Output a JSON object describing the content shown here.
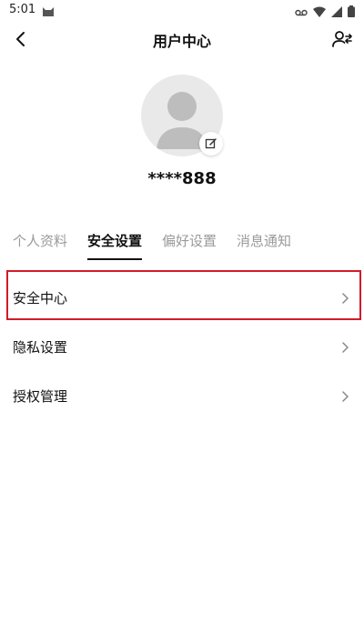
{
  "status_bar": {
    "time": "5:01",
    "icons": [
      "cat-icon",
      "voicemail-icon",
      "wifi-icon",
      "signal-icon",
      "battery-icon"
    ]
  },
  "header": {
    "title": "用户中心",
    "back_icon": "chevron-left-icon",
    "switch_icon": "user-switch-icon"
  },
  "profile": {
    "username": "****888",
    "avatar_icon": "avatar-placeholder-icon",
    "edit_icon": "edit-icon"
  },
  "tabs": [
    {
      "label": "个人资料",
      "active": false
    },
    {
      "label": "安全设置",
      "active": true
    },
    {
      "label": "偏好设置",
      "active": false
    },
    {
      "label": "消息通知",
      "active": false
    }
  ],
  "menu": [
    {
      "label": "安全中心",
      "highlighted": true
    },
    {
      "label": "隐私设置",
      "highlighted": false
    },
    {
      "label": "授权管理",
      "highlighted": false
    }
  ],
  "colors": {
    "accent": "#111111",
    "highlight_border": "#d11a2a",
    "avatar_bg": "#e9e9e9"
  }
}
